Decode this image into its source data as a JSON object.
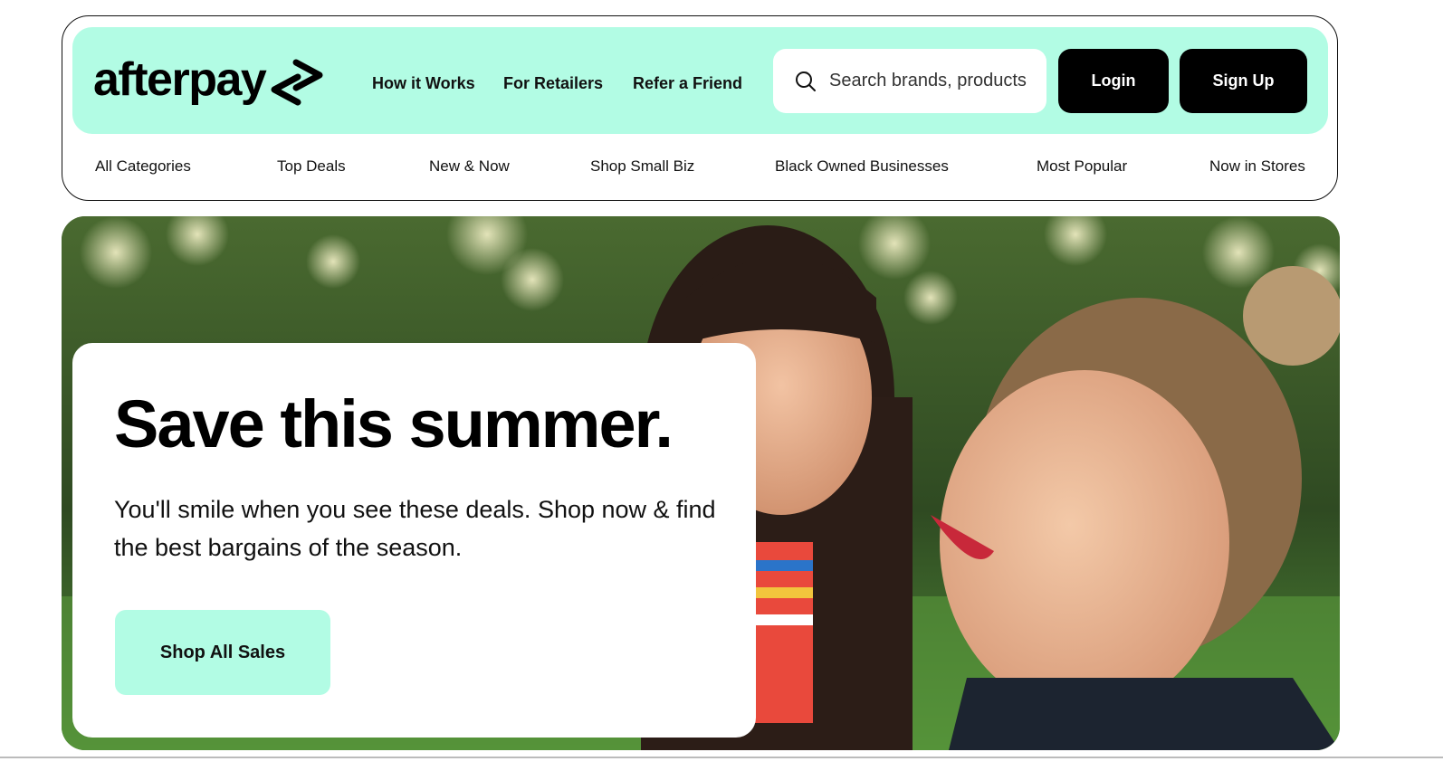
{
  "header": {
    "logo_text": "afterpay",
    "nav": [
      "How it Works",
      "For Retailers",
      "Refer a Friend"
    ],
    "search_placeholder": "Search brands, products",
    "login_label": "Login",
    "signup_label": "Sign Up",
    "brand_color": "#b2fce4"
  },
  "categories": [
    "All Categories",
    "Top Deals",
    "New & Now",
    "Shop Small Biz",
    "Black Owned Businesses",
    "Most Popular",
    "Now in Stores"
  ],
  "hero": {
    "title": "Save this summer.",
    "subtitle": "You'll smile when you see these deals. Shop now & find the best bargains of the season.",
    "cta_label": "Shop All Sales",
    "image_alt": "two laughing women outdoors"
  }
}
